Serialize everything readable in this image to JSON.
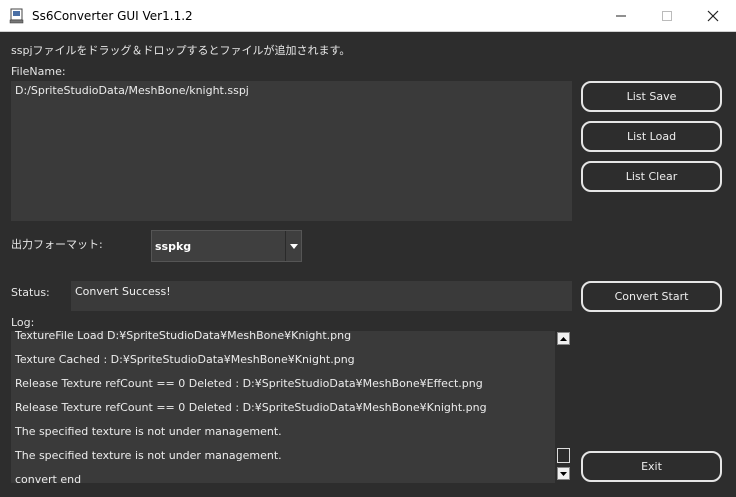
{
  "window": {
    "title": "Ss6Converter GUI Ver1.1.2"
  },
  "instruction": "sspjファイルをドラッグ＆ドロップするとファイルが追加されます。",
  "file_list": {
    "label": "FileName:",
    "items": [
      "D:/SpriteStudioData/MeshBone/knight.sspj"
    ]
  },
  "format": {
    "label": "出力フォーマット:",
    "selected": "sspkg"
  },
  "status": {
    "label": "Status:",
    "value": "Convert Success!"
  },
  "log": {
    "label": "Log:",
    "lines": [
      "TextureFile Load D:¥SpriteStudioData¥MeshBone¥Knight.png",
      "Texture Cached : D:¥SpriteStudioData¥MeshBone¥Knight.png",
      "Release Texture refCount == 0  Deleted : D:¥SpriteStudioData¥MeshBone¥Effect.png",
      "Release Texture refCount == 0  Deleted : D:¥SpriteStudioData¥MeshBone¥Knight.png",
      "The specified texture is not under management.",
      "The specified texture is not under management.",
      "convert end"
    ]
  },
  "buttons": {
    "list_save": "List Save",
    "list_load": "List Load",
    "list_clear": "List Clear",
    "convert_start": "Convert Start",
    "exit": "Exit"
  }
}
